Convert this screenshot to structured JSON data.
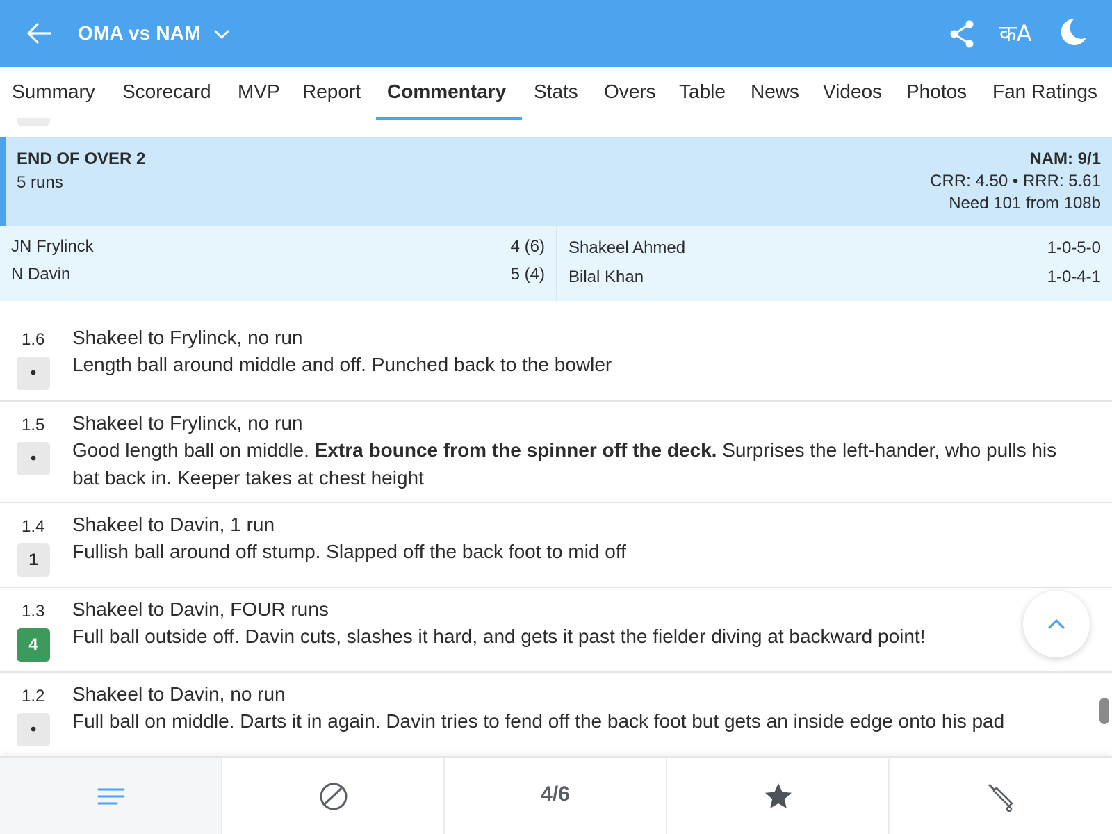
{
  "header": {
    "title": "OMA vs NAM",
    "lang_label": "कA",
    "bg_color": "#4ca4ee"
  },
  "tabs": [
    {
      "label": "Summary"
    },
    {
      "label": "Scorecard"
    },
    {
      "label": "MVP"
    },
    {
      "label": "Report"
    },
    {
      "label": "Commentary",
      "active": true
    },
    {
      "label": "Stats"
    },
    {
      "label": "Overs"
    },
    {
      "label": "Table"
    },
    {
      "label": "News"
    },
    {
      "label": "Videos"
    },
    {
      "label": "Photos"
    },
    {
      "label": "Fan Ratings"
    }
  ],
  "over_summary": {
    "title": "END OF OVER 2",
    "runs": "5 runs",
    "score": "NAM: 9/1",
    "rates": "CRR: 4.50 • RRR: 5.61",
    "need": "Need 101 from 108b",
    "batters": [
      {
        "name": "JN Frylinck",
        "stat": "4 (6)"
      },
      {
        "name": "N Davin",
        "stat": "5 (4)"
      }
    ],
    "bowlers": [
      {
        "name": "Shakeel Ahmed",
        "stat": "1-0-5-0"
      },
      {
        "name": "Bilal Khan",
        "stat": "1-0-4-1"
      }
    ]
  },
  "commentary": [
    {
      "over": "1.6",
      "badge": "•",
      "head": "Shakeel to Frylinck, no run",
      "body_pre": "Length ball around middle and off. Punched back to the bowler",
      "body_bold": "",
      "body_post": ""
    },
    {
      "over": "1.5",
      "badge": "•",
      "head": "Shakeel to Frylinck, no run",
      "body_pre": "Good length ball on middle. ",
      "body_bold": "Extra bounce from the spinner off the deck.",
      "body_post": " Surprises the left-hander, who pulls his bat back in. Keeper takes at chest height"
    },
    {
      "over": "1.4",
      "badge": "1",
      "head": "Shakeel to Davin, 1 run",
      "body_pre": "Fullish ball around off stump. Slapped off the back foot to mid off",
      "body_bold": "",
      "body_post": ""
    },
    {
      "over": "1.3",
      "badge": "4",
      "head": "Shakeel to Davin, FOUR runs",
      "body_pre": "Full ball outside off. Davin cuts, slashes it hard, and gets it past the fielder diving at backward point!",
      "body_bold": "",
      "body_post": ""
    },
    {
      "over": "1.2",
      "badge": "•",
      "head": "Shakeel to Davin, no run",
      "body_pre": "Full ball on middle. Darts it in again. Davin tries to fend off the back foot but gets an inside edge onto his pad",
      "body_bold": "",
      "body_post": ""
    }
  ],
  "bottom_nav": {
    "items": [
      {
        "icon": "menu-lines-icon"
      },
      {
        "icon": "ball-icon"
      },
      {
        "label": "4/6"
      },
      {
        "icon": "star-icon"
      },
      {
        "icon": "cricket-bat-icon"
      }
    ]
  },
  "colors": {
    "accent": "#4ca4ee",
    "four_badge": "#3b9a5c",
    "summary_bg": "#cde8fa",
    "players_bg": "#e7f5fd"
  }
}
